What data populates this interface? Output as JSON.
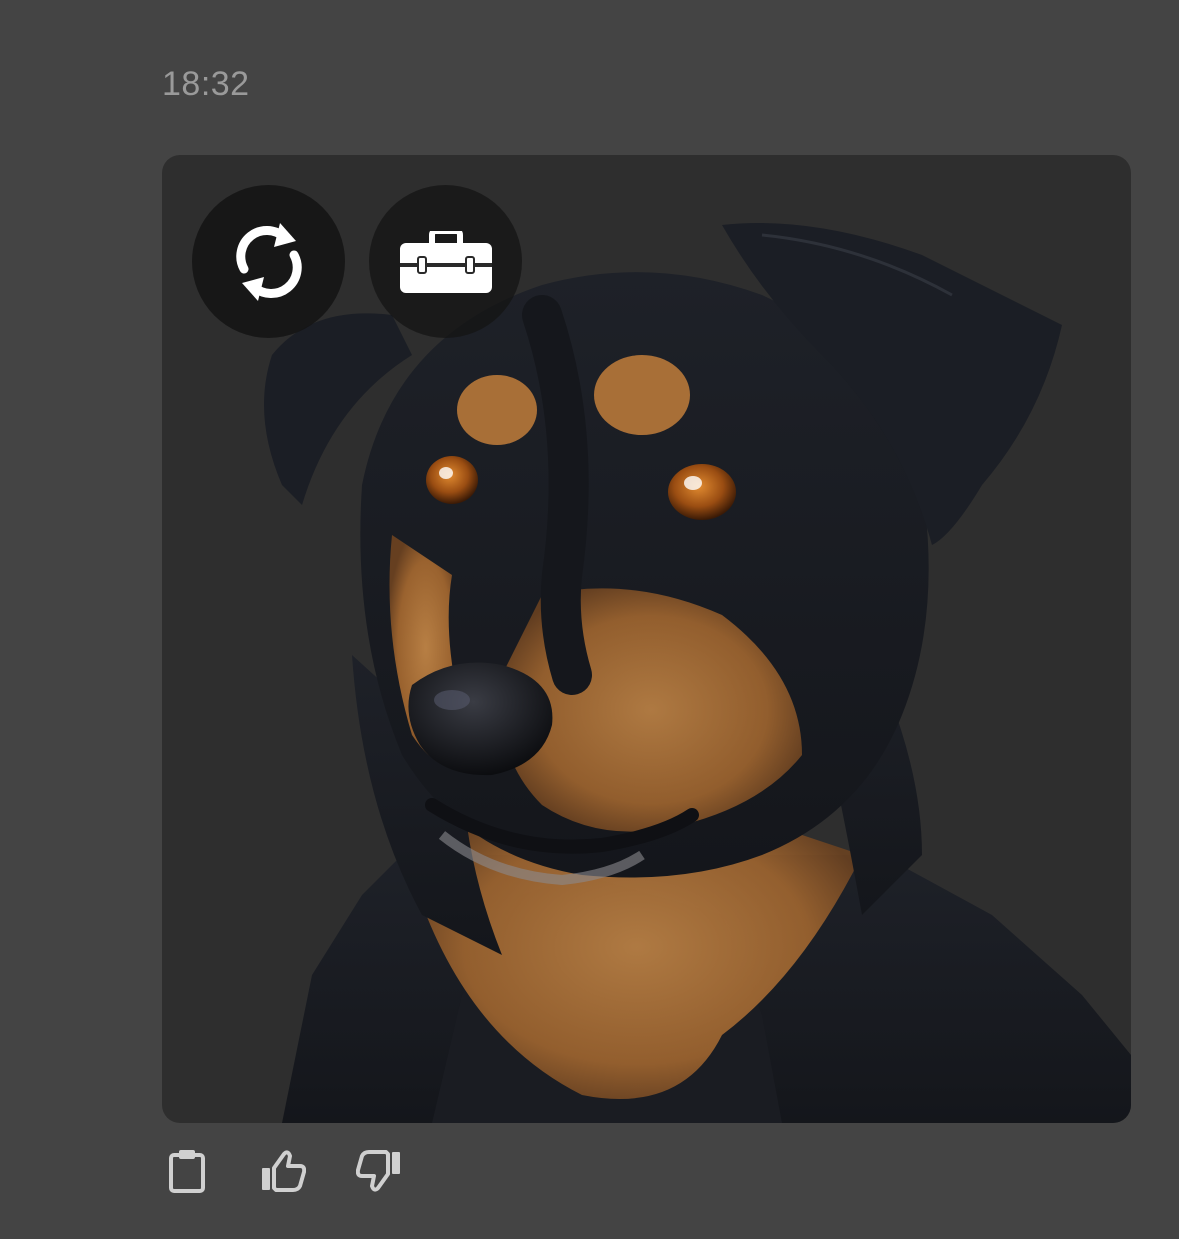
{
  "message": {
    "timestamp": "18:32"
  },
  "image_actions": {
    "regenerate_icon": "refresh-icon",
    "toolbox_icon": "toolbox-icon"
  },
  "message_actions": [
    {
      "icon": "clipboard-icon"
    },
    {
      "icon": "thumbs-up-icon"
    },
    {
      "icon": "thumbs-down-icon"
    }
  ],
  "colors": {
    "background": "#444444",
    "card": "#2e2e2e",
    "timestamp": "#9a9a9a",
    "icon": "#d0d0d0",
    "overlay": "#141414"
  }
}
